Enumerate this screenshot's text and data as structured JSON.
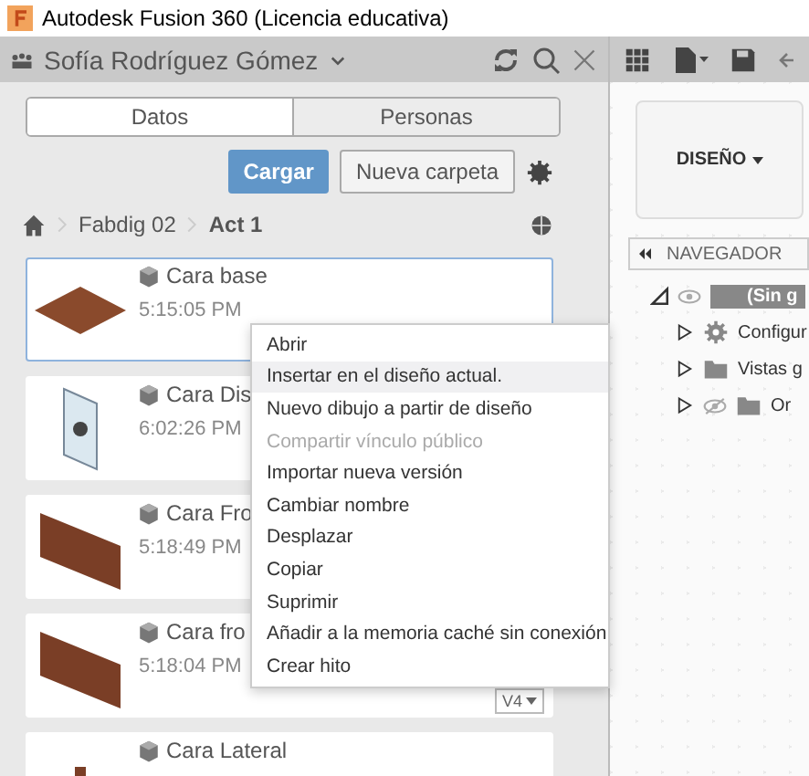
{
  "window": {
    "title": "Autodesk Fusion 360 (Licencia educativa)"
  },
  "header": {
    "user": "Sofía Rodríguez Gómez"
  },
  "tabs": [
    {
      "label": "Datos",
      "selected": true
    },
    {
      "label": "Personas",
      "selected": false
    }
  ],
  "actions": {
    "upload": "Cargar",
    "new_folder": "Nueva carpeta"
  },
  "breadcrumb": [
    "Fabdig 02",
    "Act 1"
  ],
  "files": [
    {
      "name": "Cara base",
      "time": "5:15:05 PM",
      "kind": "flat",
      "selected": true
    },
    {
      "name": "Cara Dis",
      "time": "6:02:26 PM",
      "kind": "sign",
      "selected": false
    },
    {
      "name": "Cara Fro",
      "time": "5:18:49 PM",
      "kind": "panel",
      "selected": false
    },
    {
      "name": "Cara fro",
      "time": "5:18:04 PM",
      "kind": "panel",
      "selected": false,
      "version": "V4"
    },
    {
      "name": "Cara Lateral",
      "kind": "post",
      "selected": false
    }
  ],
  "context_menu": [
    {
      "label": "Abrir",
      "disabled": false,
      "selected": false
    },
    {
      "label": "Insertar en el diseño actual.",
      "disabled": false,
      "selected": true
    },
    {
      "label": "Nuevo dibujo a partir de diseño",
      "disabled": false,
      "selected": false
    },
    {
      "label": "Compartir vínculo público",
      "disabled": true,
      "selected": false
    },
    {
      "label": "Importar nueva versión",
      "disabled": false,
      "selected": false
    },
    {
      "label": "Cambiar nombre",
      "disabled": false,
      "selected": false
    },
    {
      "label": "Desplazar",
      "disabled": false,
      "selected": false
    },
    {
      "label": "Copiar",
      "disabled": false,
      "selected": false
    },
    {
      "label": "Suprimir",
      "disabled": false,
      "selected": false
    },
    {
      "label": "Añadir a la memoria caché sin conexión",
      "disabled": false,
      "selected": false
    },
    {
      "label": "Crear hito",
      "disabled": false,
      "selected": false
    }
  ],
  "workspace": {
    "label": "DISEÑO"
  },
  "browser": {
    "title": "NAVEGADOR",
    "items": [
      {
        "label": "(Sin g",
        "kind": "root",
        "hidden": false
      },
      {
        "label": "Configur",
        "kind": "settings",
        "hidden": false
      },
      {
        "label": "Vistas g",
        "kind": "folder",
        "hidden": false
      },
      {
        "label": "Or",
        "kind": "folder",
        "hidden": true
      }
    ]
  }
}
